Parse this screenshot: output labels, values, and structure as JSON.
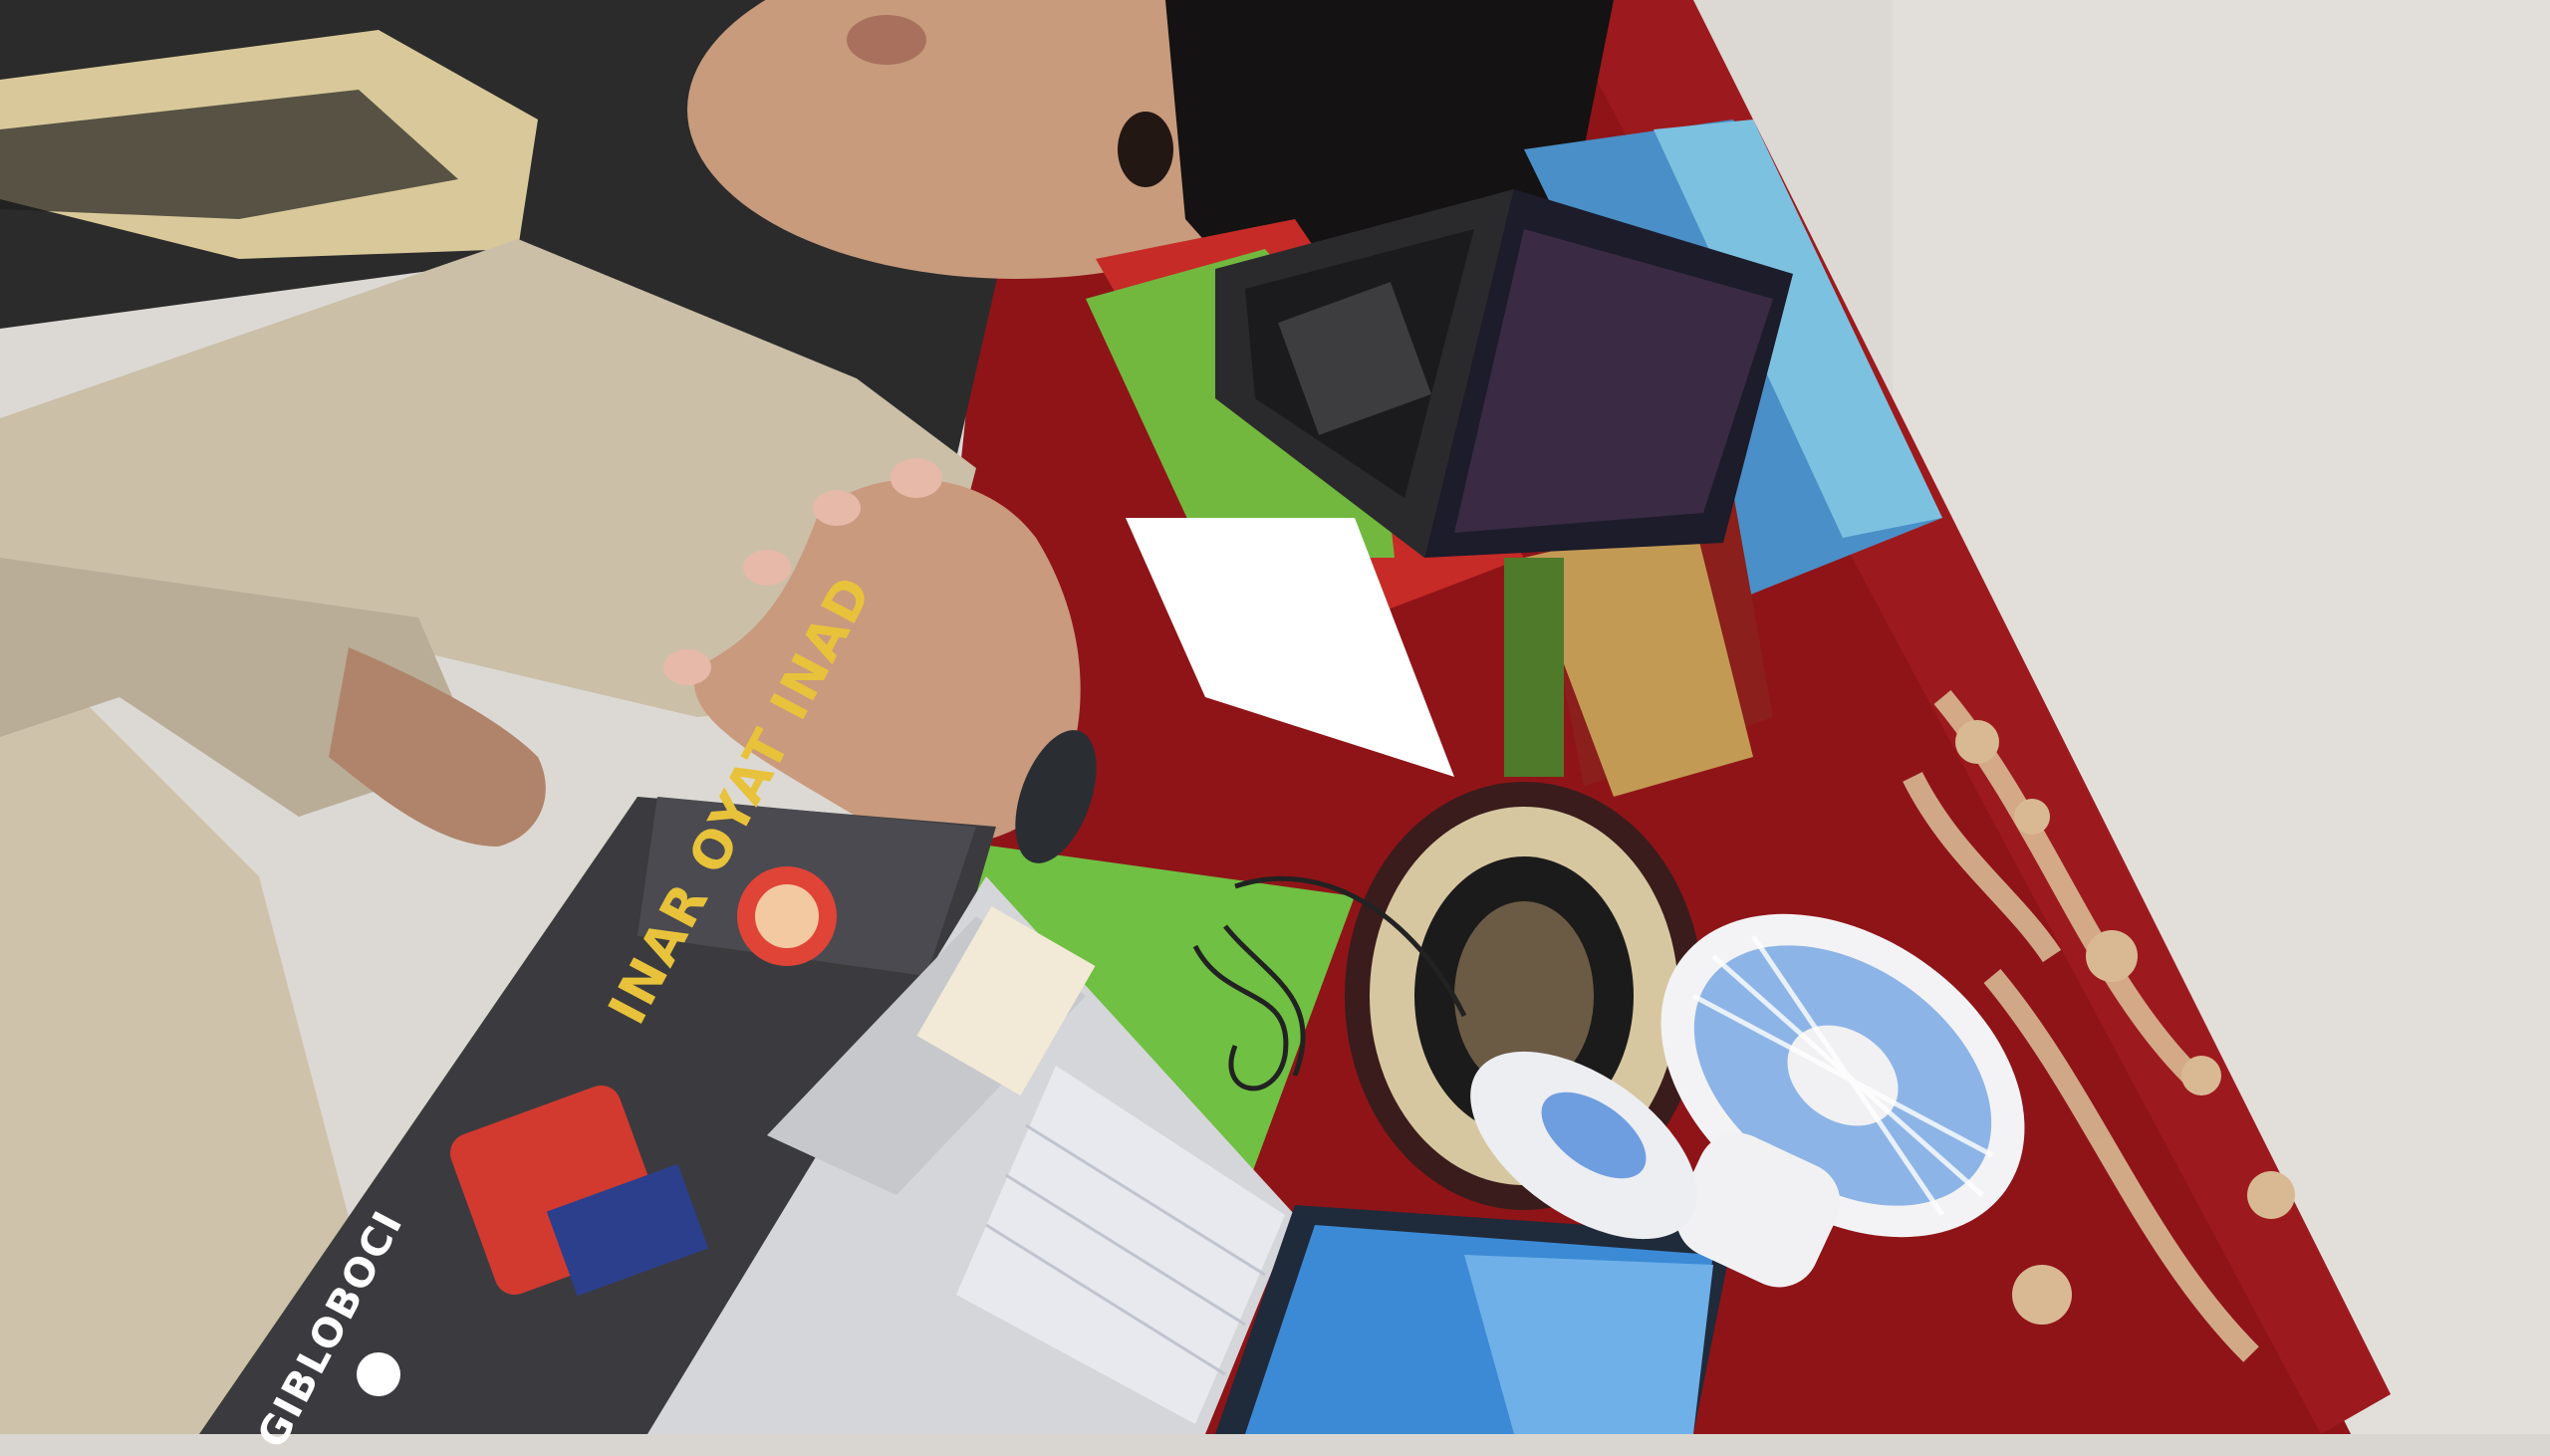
{
  "scene": {
    "description_tag": "",
    "colors": {
      "wall": "#d9d6d1",
      "carpet": "#8f1418",
      "carpet_pattern": "#d8b892",
      "shirt": "#2a2a2a",
      "pants": "#c9bca6",
      "laptop_silver": "#d7d7d9",
      "laptop_black": "#2b2b2e",
      "fan_white": "#f1f1f3",
      "fan_blue": "#6f9ee0",
      "box_green": "#6fc043",
      "box_red": "#d0322c"
    },
    "icons": [
      "person",
      "laptop-silver",
      "laptop-black",
      "desk-fan",
      "toy-boxes",
      "earphones",
      "round-rug"
    ]
  },
  "box_labels": {
    "front_box_line1": "INAR OYAT INAD",
    "front_box_line2": "GIBLOBOCI"
  }
}
